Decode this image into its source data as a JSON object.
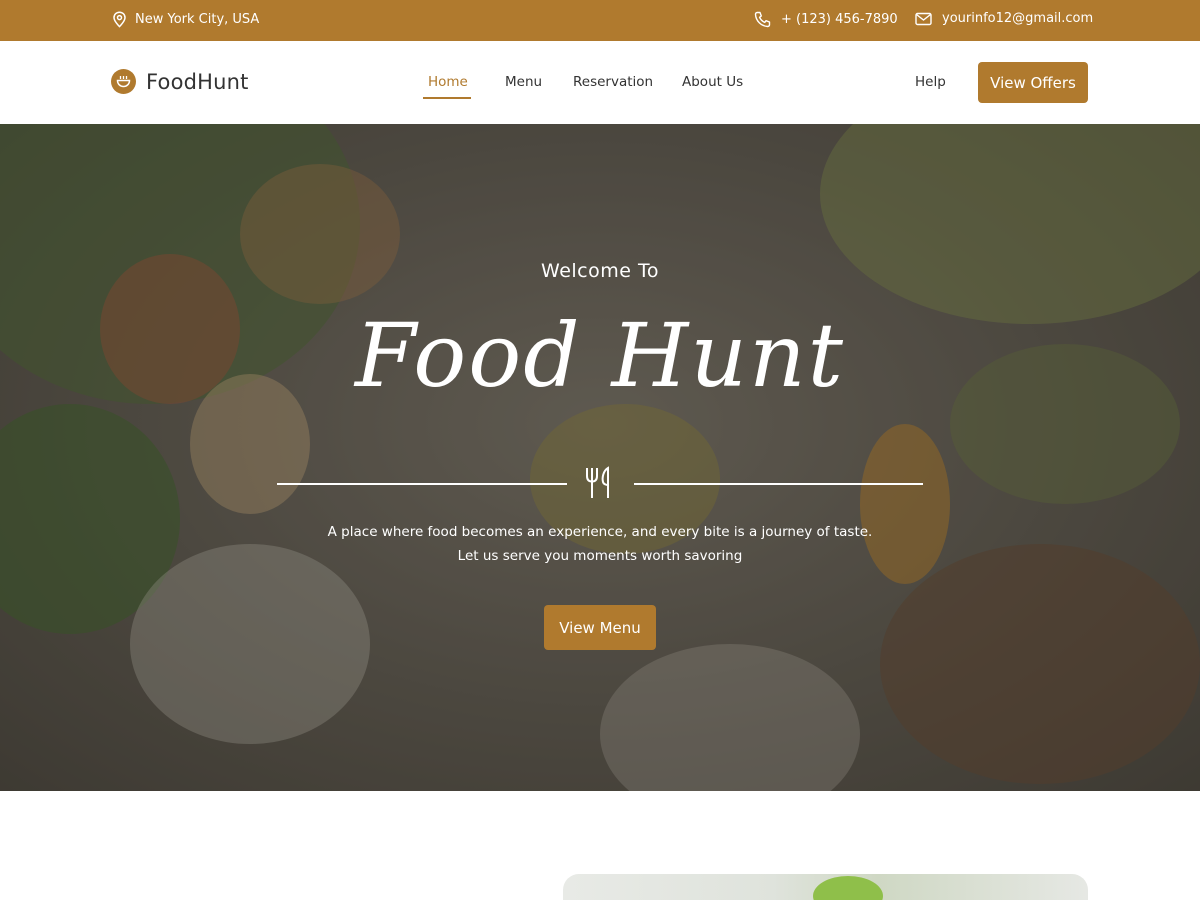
{
  "topbar": {
    "location": "New York City, USA",
    "phone": "+ (123) 456-7890",
    "email": "yourinfo12@gmail.com",
    "location_icon": "location-pin-icon",
    "phone_icon": "phone-icon",
    "email_icon": "mail-icon"
  },
  "nav": {
    "brand": "FoodHunt",
    "brand_icon": "food-bowl-icon",
    "items": [
      {
        "label": "Home",
        "active": true
      },
      {
        "label": "Menu",
        "active": false
      },
      {
        "label": "Reservation",
        "active": false
      },
      {
        "label": "About Us",
        "active": false
      }
    ],
    "help": "Help",
    "cta": "View Offers"
  },
  "hero": {
    "welcome": "Welcome To",
    "title": "Food Hunt",
    "divider_icon": "cutlery-icon",
    "description": "A place where food becomes an experience, and every bite is a journey of taste. Let us serve you moments worth savoring",
    "cta": "View Menu"
  },
  "colors": {
    "accent": "#b07a2e",
    "text": "#333333",
    "white": "#ffffff"
  }
}
